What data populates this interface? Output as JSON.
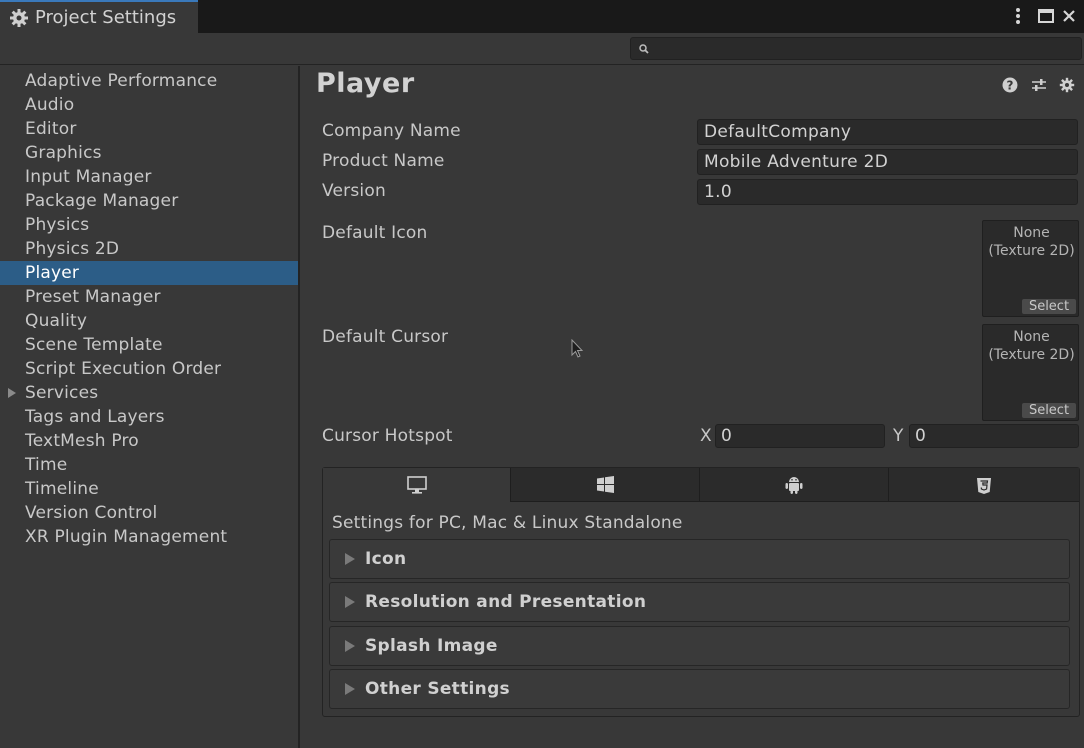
{
  "window": {
    "tab_title": "Project Settings"
  },
  "search": {
    "placeholder": ""
  },
  "sidebar": {
    "items": [
      {
        "label": "Adaptive Performance"
      },
      {
        "label": "Audio"
      },
      {
        "label": "Editor"
      },
      {
        "label": "Graphics"
      },
      {
        "label": "Input Manager"
      },
      {
        "label": "Package Manager"
      },
      {
        "label": "Physics"
      },
      {
        "label": "Physics 2D"
      },
      {
        "label": "Player",
        "selected": true
      },
      {
        "label": "Preset Manager"
      },
      {
        "label": "Quality"
      },
      {
        "label": "Scene Template"
      },
      {
        "label": "Script Execution Order"
      },
      {
        "label": "Services",
        "expandable": true
      },
      {
        "label": "Tags and Layers"
      },
      {
        "label": "TextMesh Pro"
      },
      {
        "label": "Time"
      },
      {
        "label": "Timeline"
      },
      {
        "label": "Version Control"
      },
      {
        "label": "XR Plugin Management"
      }
    ]
  },
  "main": {
    "title": "Player",
    "header_icons": [
      "help-icon",
      "preset-sliders-icon",
      "settings-gear-icon"
    ],
    "company_name_label": "Company Name",
    "company_name_value": "DefaultCompany",
    "product_name_label": "Product Name",
    "product_name_value": "Mobile Adventure 2D",
    "version_label": "Version",
    "version_value": "1.0",
    "default_icon_label": "Default Icon",
    "default_icon_none": "None",
    "default_icon_type": "(Texture 2D)",
    "default_icon_select": "Select",
    "default_cursor_label": "Default Cursor",
    "default_cursor_none": "None",
    "default_cursor_type": "(Texture 2D)",
    "default_cursor_select": "Select",
    "cursor_hotspot_label": "Cursor Hotspot",
    "hotspot_x_label": "X",
    "hotspot_x_value": "0",
    "hotspot_y_label": "Y",
    "hotspot_y_value": "0"
  },
  "platforms": {
    "tabs": [
      "desktop-monitor-icon",
      "windows-logo-icon",
      "android-icon",
      "html5-icon"
    ],
    "active_tab": 0,
    "caption": "Settings for PC, Mac & Linux Standalone",
    "sections": [
      {
        "title": "Icon"
      },
      {
        "title": "Resolution and Presentation"
      },
      {
        "title": "Splash Image"
      },
      {
        "title": "Other Settings"
      }
    ]
  },
  "colors": {
    "background": "#383838",
    "selection": "#2c5d87",
    "field_bg": "#2a2a2a",
    "tab_accent": "#3a79bb"
  }
}
